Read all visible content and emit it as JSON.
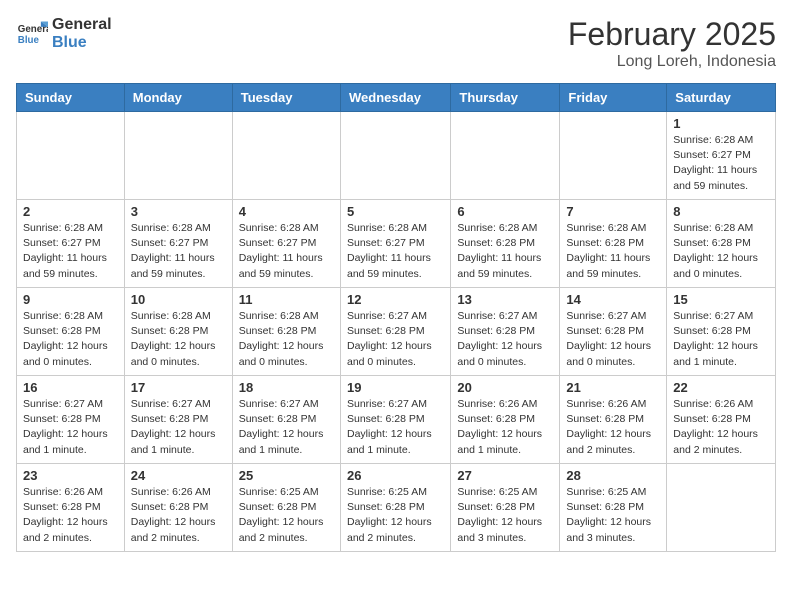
{
  "header": {
    "logo_general": "General",
    "logo_blue": "Blue",
    "month_title": "February 2025",
    "location": "Long Loreh, Indonesia"
  },
  "days_of_week": [
    "Sunday",
    "Monday",
    "Tuesday",
    "Wednesday",
    "Thursday",
    "Friday",
    "Saturday"
  ],
  "weeks": [
    [
      {
        "day": "",
        "info": ""
      },
      {
        "day": "",
        "info": ""
      },
      {
        "day": "",
        "info": ""
      },
      {
        "day": "",
        "info": ""
      },
      {
        "day": "",
        "info": ""
      },
      {
        "day": "",
        "info": ""
      },
      {
        "day": "1",
        "info": "Sunrise: 6:28 AM\nSunset: 6:27 PM\nDaylight: 11 hours and 59 minutes."
      }
    ],
    [
      {
        "day": "2",
        "info": "Sunrise: 6:28 AM\nSunset: 6:27 PM\nDaylight: 11 hours and 59 minutes."
      },
      {
        "day": "3",
        "info": "Sunrise: 6:28 AM\nSunset: 6:27 PM\nDaylight: 11 hours and 59 minutes."
      },
      {
        "day": "4",
        "info": "Sunrise: 6:28 AM\nSunset: 6:27 PM\nDaylight: 11 hours and 59 minutes."
      },
      {
        "day": "5",
        "info": "Sunrise: 6:28 AM\nSunset: 6:27 PM\nDaylight: 11 hours and 59 minutes."
      },
      {
        "day": "6",
        "info": "Sunrise: 6:28 AM\nSunset: 6:28 PM\nDaylight: 11 hours and 59 minutes."
      },
      {
        "day": "7",
        "info": "Sunrise: 6:28 AM\nSunset: 6:28 PM\nDaylight: 11 hours and 59 minutes."
      },
      {
        "day": "8",
        "info": "Sunrise: 6:28 AM\nSunset: 6:28 PM\nDaylight: 12 hours and 0 minutes."
      }
    ],
    [
      {
        "day": "9",
        "info": "Sunrise: 6:28 AM\nSunset: 6:28 PM\nDaylight: 12 hours and 0 minutes."
      },
      {
        "day": "10",
        "info": "Sunrise: 6:28 AM\nSunset: 6:28 PM\nDaylight: 12 hours and 0 minutes."
      },
      {
        "day": "11",
        "info": "Sunrise: 6:28 AM\nSunset: 6:28 PM\nDaylight: 12 hours and 0 minutes."
      },
      {
        "day": "12",
        "info": "Sunrise: 6:27 AM\nSunset: 6:28 PM\nDaylight: 12 hours and 0 minutes."
      },
      {
        "day": "13",
        "info": "Sunrise: 6:27 AM\nSunset: 6:28 PM\nDaylight: 12 hours and 0 minutes."
      },
      {
        "day": "14",
        "info": "Sunrise: 6:27 AM\nSunset: 6:28 PM\nDaylight: 12 hours and 0 minutes."
      },
      {
        "day": "15",
        "info": "Sunrise: 6:27 AM\nSunset: 6:28 PM\nDaylight: 12 hours and 1 minute."
      }
    ],
    [
      {
        "day": "16",
        "info": "Sunrise: 6:27 AM\nSunset: 6:28 PM\nDaylight: 12 hours and 1 minute."
      },
      {
        "day": "17",
        "info": "Sunrise: 6:27 AM\nSunset: 6:28 PM\nDaylight: 12 hours and 1 minute."
      },
      {
        "day": "18",
        "info": "Sunrise: 6:27 AM\nSunset: 6:28 PM\nDaylight: 12 hours and 1 minute."
      },
      {
        "day": "19",
        "info": "Sunrise: 6:27 AM\nSunset: 6:28 PM\nDaylight: 12 hours and 1 minute."
      },
      {
        "day": "20",
        "info": "Sunrise: 6:26 AM\nSunset: 6:28 PM\nDaylight: 12 hours and 1 minute."
      },
      {
        "day": "21",
        "info": "Sunrise: 6:26 AM\nSunset: 6:28 PM\nDaylight: 12 hours and 2 minutes."
      },
      {
        "day": "22",
        "info": "Sunrise: 6:26 AM\nSunset: 6:28 PM\nDaylight: 12 hours and 2 minutes."
      }
    ],
    [
      {
        "day": "23",
        "info": "Sunrise: 6:26 AM\nSunset: 6:28 PM\nDaylight: 12 hours and 2 minutes."
      },
      {
        "day": "24",
        "info": "Sunrise: 6:26 AM\nSunset: 6:28 PM\nDaylight: 12 hours and 2 minutes."
      },
      {
        "day": "25",
        "info": "Sunrise: 6:25 AM\nSunset: 6:28 PM\nDaylight: 12 hours and 2 minutes."
      },
      {
        "day": "26",
        "info": "Sunrise: 6:25 AM\nSunset: 6:28 PM\nDaylight: 12 hours and 2 minutes."
      },
      {
        "day": "27",
        "info": "Sunrise: 6:25 AM\nSunset: 6:28 PM\nDaylight: 12 hours and 3 minutes."
      },
      {
        "day": "28",
        "info": "Sunrise: 6:25 AM\nSunset: 6:28 PM\nDaylight: 12 hours and 3 minutes."
      },
      {
        "day": "",
        "info": ""
      }
    ]
  ]
}
